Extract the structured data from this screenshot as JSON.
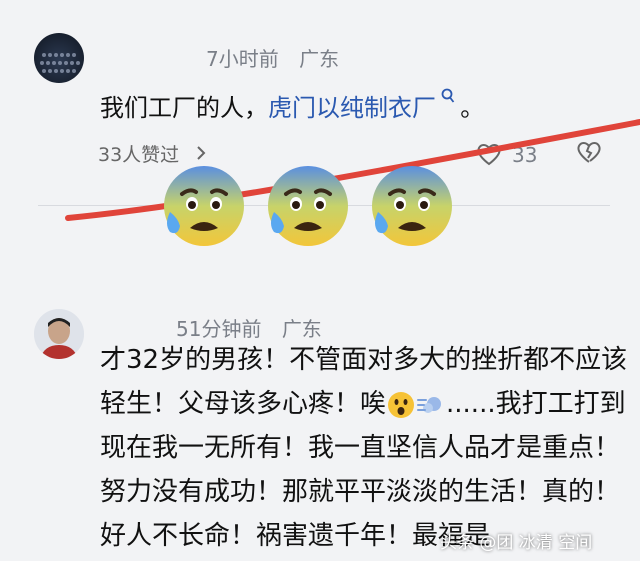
{
  "comment1": {
    "time": "7小时前",
    "location": "广东",
    "text_before": "我们工厂的人，",
    "link_text": "虎门以纯制衣厂",
    "text_after": "。",
    "likes_summary": "33人赞过",
    "like_count": "33"
  },
  "comment2": {
    "time": "51分钟前",
    "location": "广东",
    "text_part1": "才32岁的男孩！不管面对多大的挫折都不应该轻生！父母该多心疼！唉",
    "text_part2": "......我打工打到现在我一无所有！我一直坚信人品才是重点！努力没有成功！那就平平淡淡的生活！真的！好人不长命！祸害遗千年！最福是"
  },
  "watermark": {
    "text": "头条 @团 冰清 空间"
  },
  "colors": {
    "link": "#2b59b0",
    "strike_line": "#e0443a",
    "background": "#f2f3f5"
  },
  "icons": {
    "search": "search-icon",
    "chevron": "chevron-right-icon",
    "heart": "heart-icon",
    "broken_heart": "broken-heart-icon",
    "emoji": "anxious-sweat-face-icon"
  }
}
